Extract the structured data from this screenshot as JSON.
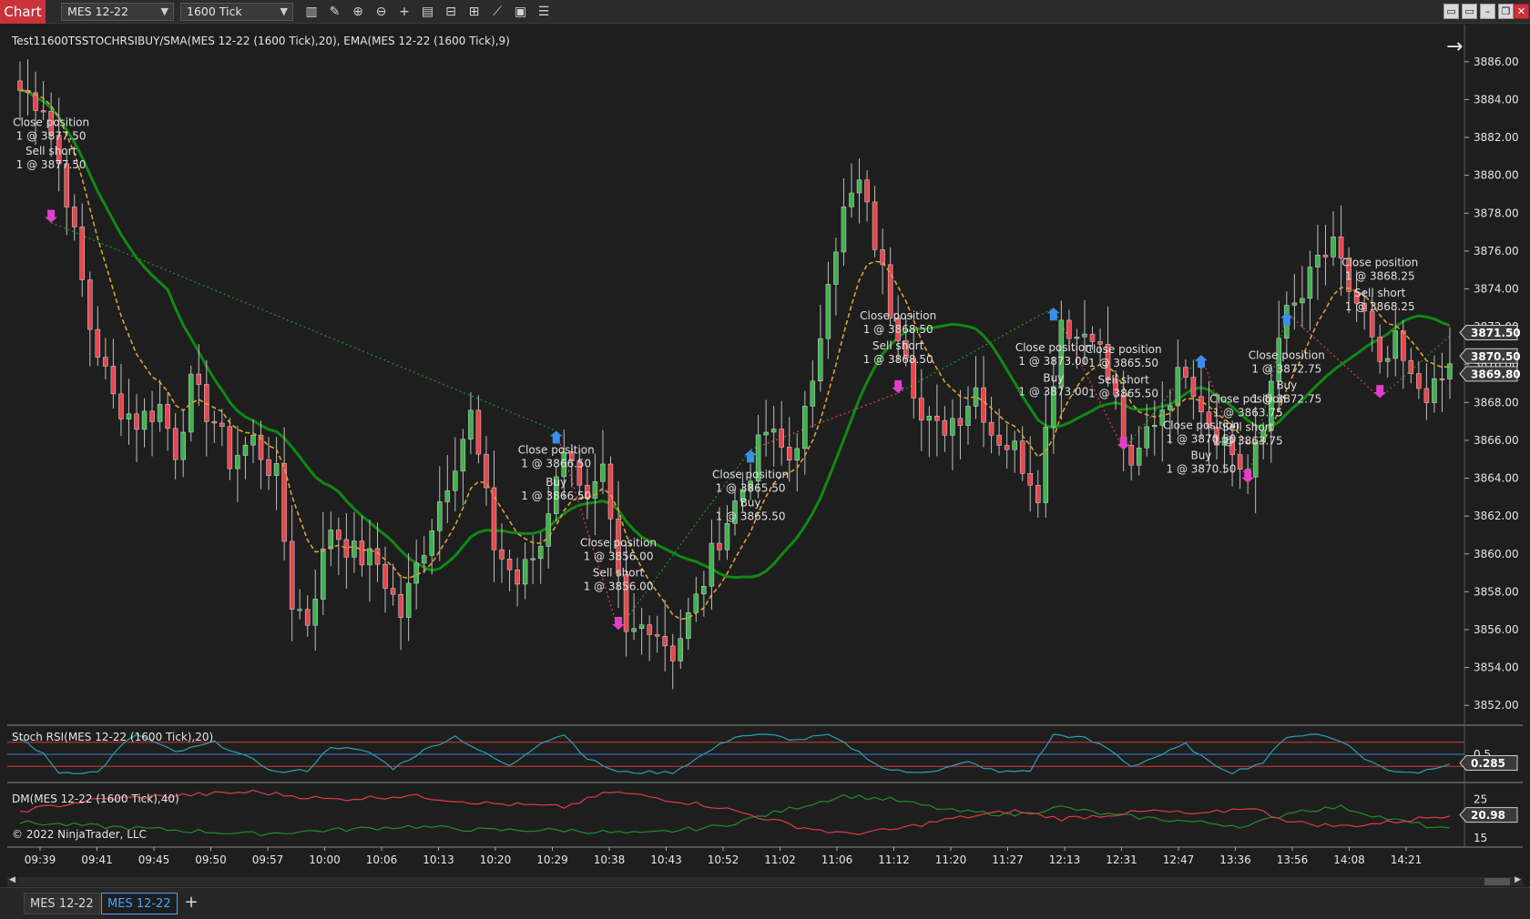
{
  "window": {
    "badge": "Chart",
    "instrument": "MES 12-22",
    "interval": "1600 Tick",
    "win_buttons": [
      "▭",
      "▭",
      "–",
      "❐",
      "✕"
    ]
  },
  "toolbar_icons": [
    "bar-style-icon",
    "drawing-tool-icon",
    "zoom-in-icon",
    "zoom-out-icon",
    "crosshair-icon",
    "data-box-icon",
    "chart-trader-icon",
    "properties-icon",
    "indicators-icon",
    "strategies-icon",
    "templates-icon"
  ],
  "main_panel": {
    "title": "Test11600TSSTOCHRSIBUY/SMA(MES 12-22 (1600 Tick),20), EMA(MES 12-22 (1600 Tick),9)",
    "price_ticks": [
      "3886.00",
      "3884.00",
      "3882.00",
      "3880.00",
      "3878.00",
      "3876.00",
      "3874.00",
      "3872.00",
      "3870.00",
      "3868.00",
      "3866.00",
      "3864.00",
      "3862.00",
      "3860.00",
      "3858.00",
      "3856.00",
      "3854.00",
      "3852.00"
    ],
    "price_markers": [
      {
        "label": "3871.50",
        "value": 3871.5
      },
      {
        "label": "3870.50",
        "value": 3870.5
      },
      {
        "label": "3869.80",
        "value": 3869.8
      }
    ]
  },
  "trade_labels": [
    {
      "lines": [
        "Close position",
        "1 @ 3877.50"
      ],
      "bar": 4,
      "price": 3882.6
    },
    {
      "lines": [
        "Sell short",
        "1 @ 3877.50"
      ],
      "bar": 4,
      "price": 3881.1
    },
    {
      "lines": [
        "Close position",
        "1 @ 3866.50"
      ],
      "bar": 69,
      "price": 3865.3
    },
    {
      "lines": [
        "Buy",
        "1 @ 3866.50"
      ],
      "bar": 69,
      "price": 3863.6
    },
    {
      "lines": [
        "Close position",
        "1 @ 3856.00"
      ],
      "bar": 77,
      "price": 3860.4
    },
    {
      "lines": [
        "Sell short",
        "1 @ 3856.00"
      ],
      "bar": 77,
      "price": 3858.8
    },
    {
      "lines": [
        "Close position",
        "1 @ 3865.50"
      ],
      "bar": 94,
      "price": 3864.0
    },
    {
      "lines": [
        "Buy",
        "1 @ 3865.50"
      ],
      "bar": 94,
      "price": 3862.5
    },
    {
      "lines": [
        "Close position",
        "1 @ 3868.50"
      ],
      "bar": 113,
      "price": 3872.4
    },
    {
      "lines": [
        "Sell short",
        "1 @ 3868.50"
      ],
      "bar": 113,
      "price": 3870.8
    },
    {
      "lines": [
        "Close position",
        "1 @ 3873.00"
      ],
      "bar": 133,
      "price": 3870.7
    },
    {
      "lines": [
        "Buy",
        "1 @ 3873.00"
      ],
      "bar": 133,
      "price": 3869.1
    },
    {
      "lines": [
        "Close position",
        "1 @ 3865.50"
      ],
      "bar": 142,
      "price": 3870.6
    },
    {
      "lines": [
        "Sell short",
        "1 @ 3865.50"
      ],
      "bar": 142,
      "price": 3869.0
    },
    {
      "lines": [
        "Close position",
        "1 @ 3870.50"
      ],
      "bar": 152,
      "price": 3866.6
    },
    {
      "lines": [
        "Buy",
        "1 @ 3870.50"
      ],
      "bar": 152,
      "price": 3865.0
    },
    {
      "lines": [
        "Close position",
        "1 @ 3863.75"
      ],
      "bar": 158,
      "price": 3868.0
    },
    {
      "lines": [
        "Sell short",
        "1 @ 3863.75"
      ],
      "bar": 158,
      "price": 3866.5
    },
    {
      "lines": [
        "Close position",
        "1 @ 3872.75"
      ],
      "bar": 163,
      "price": 3870.3
    },
    {
      "lines": [
        "Buy",
        "1 @ 3872.75"
      ],
      "bar": 163,
      "price": 3868.7
    },
    {
      "lines": [
        "Close position",
        "1 @ 3868.25"
      ],
      "bar": 175,
      "price": 3875.2
    },
    {
      "lines": [
        "Sell short",
        "1 @ 3868.25"
      ],
      "bar": 175,
      "price": 3873.6
    }
  ],
  "stoch_panel": {
    "title": "Stoch RSI(MES 12-22 (1600 Tick),20)",
    "ticks": [
      "0.5"
    ],
    "marker": {
      "label": "0.285",
      "value": 0.285
    }
  },
  "dm_panel": {
    "title": "DM(MES 12-22 (1600 Tick),40)",
    "ticks": [
      "25",
      "15"
    ],
    "marker": {
      "label": "20.98",
      "value": 20.98
    },
    "copyright": "© 2022 NinjaTrader, LLC"
  },
  "time_ticks": [
    "09:39",
    "09:41",
    "09:45",
    "09:50",
    "09:57",
    "10:00",
    "10:06",
    "10:13",
    "10:20",
    "10:29",
    "10:38",
    "10:43",
    "10:52",
    "11:02",
    "11:06",
    "11:12",
    "11:20",
    "11:27",
    "12:13",
    "12:31",
    "12:47",
    "13:36",
    "13:56",
    "14:08",
    "14:21"
  ],
  "tabs": [
    {
      "label": "MES 12-22",
      "active": false
    },
    {
      "label": "MES 12-22",
      "active": true
    }
  ],
  "tab_add": "+",
  "colors": {
    "bull": "#3fb34f",
    "bear": "#e8464f",
    "sma": "#0f8a12",
    "ema": "#d9a13a",
    "stoch": "#2aa0b4",
    "stoch_mid": "#3a7fd4",
    "stoch_band": "#d23a3a",
    "dm_plus": "#1f8f2a",
    "dm_minus": "#e03b4a",
    "marker_fill": "#3a3a3a"
  },
  "chart_data": {
    "type": "candlestick",
    "bar_count": 185,
    "ylim": [
      3851,
      3887
    ],
    "anchors": [
      [
        0,
        3884.5
      ],
      [
        3,
        3883.8
      ],
      [
        6,
        3879.0
      ],
      [
        9,
        3872.0
      ],
      [
        12,
        3868.2
      ],
      [
        15,
        3867.0
      ],
      [
        18,
        3867.8
      ],
      [
        20,
        3865.5
      ],
      [
        22,
        3868.8
      ],
      [
        25,
        3867.0
      ],
      [
        27,
        3865.0
      ],
      [
        30,
        3866.0
      ],
      [
        33,
        3864.0
      ],
      [
        35,
        3857.5
      ],
      [
        37,
        3856.5
      ],
      [
        40,
        3861.5
      ],
      [
        43,
        3860.0
      ],
      [
        46,
        3859.5
      ],
      [
        49,
        3856.8
      ],
      [
        52,
        3860.5
      ],
      [
        55,
        3864.0
      ],
      [
        58,
        3867.3
      ],
      [
        61,
        3860.5
      ],
      [
        64,
        3858.5
      ],
      [
        67,
        3860.5
      ],
      [
        69,
        3864.5
      ],
      [
        71,
        3865.5
      ],
      [
        73,
        3862.5
      ],
      [
        75,
        3864.0
      ],
      [
        78,
        3855.5
      ],
      [
        81,
        3856.5
      ],
      [
        84,
        3854.8
      ],
      [
        87,
        3857.5
      ],
      [
        90,
        3861.0
      ],
      [
        93,
        3863.5
      ],
      [
        96,
        3866.5
      ],
      [
        99,
        3865.0
      ],
      [
        102,
        3868.5
      ],
      [
        104,
        3875.0
      ],
      [
        106,
        3878.0
      ],
      [
        108,
        3879.5
      ],
      [
        110,
        3876.5
      ],
      [
        112,
        3873.0
      ],
      [
        114,
        3871.0
      ],
      [
        116,
        3867.0
      ],
      [
        118,
        3866.5
      ],
      [
        121,
        3867.5
      ],
      [
        123,
        3868.8
      ],
      [
        125,
        3866.5
      ],
      [
        128,
        3865.5
      ],
      [
        131,
        3863.5
      ],
      [
        134,
        3872.5
      ],
      [
        136,
        3871.5
      ],
      [
        138,
        3872.0
      ],
      [
        141,
        3868.0
      ],
      [
        143,
        3864.0
      ],
      [
        145,
        3866.5
      ],
      [
        148,
        3868.5
      ],
      [
        150,
        3870.0
      ],
      [
        153,
        3867.0
      ],
      [
        155,
        3866.0
      ],
      [
        158,
        3864.0
      ],
      [
        160,
        3866.5
      ],
      [
        162,
        3872.0
      ],
      [
        165,
        3873.5
      ],
      [
        167,
        3875.5
      ],
      [
        169,
        3876.0
      ],
      [
        171,
        3874.0
      ],
      [
        173,
        3872.5
      ],
      [
        175,
        3869.5
      ],
      [
        177,
        3871.0
      ],
      [
        179,
        3869.0
      ],
      [
        182,
        3868.5
      ],
      [
        184,
        3869.8
      ]
    ],
    "trade_path": [
      [
        4,
        3877.5
      ],
      [
        69,
        3866.5
      ],
      [
        77,
        3856.0
      ],
      [
        94,
        3865.5
      ],
      [
        113,
        3868.5
      ],
      [
        133,
        3873.0
      ],
      [
        142,
        3865.5
      ],
      [
        152,
        3870.5
      ],
      [
        158,
        3863.75
      ],
      [
        163,
        3872.75
      ],
      [
        175,
        3868.25
      ],
      [
        184,
        3871.5
      ]
    ],
    "stoch_anchors": [
      [
        0,
        0.9
      ],
      [
        3,
        0.5
      ],
      [
        5,
        0.05
      ],
      [
        10,
        0.05
      ],
      [
        13,
        0.7
      ],
      [
        15,
        1.0
      ],
      [
        20,
        0.55
      ],
      [
        25,
        0.8
      ],
      [
        30,
        0.35
      ],
      [
        33,
        0.05
      ],
      [
        37,
        0.1
      ],
      [
        40,
        0.7
      ],
      [
        45,
        0.55
      ],
      [
        48,
        0.15
      ],
      [
        52,
        0.6
      ],
      [
        56,
        0.95
      ],
      [
        60,
        0.5
      ],
      [
        63,
        0.2
      ],
      [
        67,
        0.8
      ],
      [
        70,
        1.0
      ],
      [
        73,
        0.4
      ],
      [
        77,
        0.05
      ],
      [
        80,
        0.05
      ],
      [
        84,
        0.05
      ],
      [
        88,
        0.5
      ],
      [
        92,
        0.95
      ],
      [
        96,
        1.0
      ],
      [
        100,
        0.85
      ],
      [
        104,
        1.0
      ],
      [
        108,
        0.55
      ],
      [
        111,
        0.15
      ],
      [
        114,
        0.05
      ],
      [
        118,
        0.1
      ],
      [
        122,
        0.3
      ],
      [
        126,
        0.05
      ],
      [
        130,
        0.1
      ],
      [
        133,
        1.0
      ],
      [
        137,
        0.9
      ],
      [
        140,
        0.65
      ],
      [
        143,
        0.2
      ],
      [
        147,
        0.5
      ],
      [
        150,
        0.75
      ],
      [
        153,
        0.3
      ],
      [
        156,
        0.05
      ],
      [
        160,
        0.3
      ],
      [
        163,
        0.95
      ],
      [
        167,
        1.0
      ],
      [
        170,
        0.85
      ],
      [
        173,
        0.4
      ],
      [
        176,
        0.1
      ],
      [
        180,
        0.05
      ],
      [
        184,
        0.285
      ]
    ],
    "dm_plus_anchors": [
      [
        0,
        19
      ],
      [
        10,
        18
      ],
      [
        20,
        17
      ],
      [
        30,
        16
      ],
      [
        40,
        17
      ],
      [
        50,
        18
      ],
      [
        60,
        17
      ],
      [
        70,
        17
      ],
      [
        80,
        16
      ],
      [
        90,
        18
      ],
      [
        100,
        23
      ],
      [
        106,
        26
      ],
      [
        112,
        25
      ],
      [
        120,
        22
      ],
      [
        128,
        21
      ],
      [
        134,
        23
      ],
      [
        140,
        21
      ],
      [
        146,
        20
      ],
      [
        152,
        19
      ],
      [
        158,
        18
      ],
      [
        164,
        22
      ],
      [
        170,
        23
      ],
      [
        176,
        20
      ],
      [
        184,
        17
      ]
    ],
    "dm_minus_anchors": [
      [
        0,
        22
      ],
      [
        10,
        25
      ],
      [
        20,
        26
      ],
      [
        30,
        27
      ],
      [
        40,
        25
      ],
      [
        50,
        26
      ],
      [
        60,
        24
      ],
      [
        70,
        23
      ],
      [
        76,
        27
      ],
      [
        80,
        26
      ],
      [
        90,
        23
      ],
      [
        100,
        18
      ],
      [
        106,
        16
      ],
      [
        112,
        17
      ],
      [
        120,
        20
      ],
      [
        128,
        22
      ],
      [
        134,
        20
      ],
      [
        140,
        21
      ],
      [
        146,
        22
      ],
      [
        152,
        21
      ],
      [
        158,
        23
      ],
      [
        164,
        19
      ],
      [
        170,
        18
      ],
      [
        176,
        19
      ],
      [
        184,
        21
      ]
    ]
  }
}
